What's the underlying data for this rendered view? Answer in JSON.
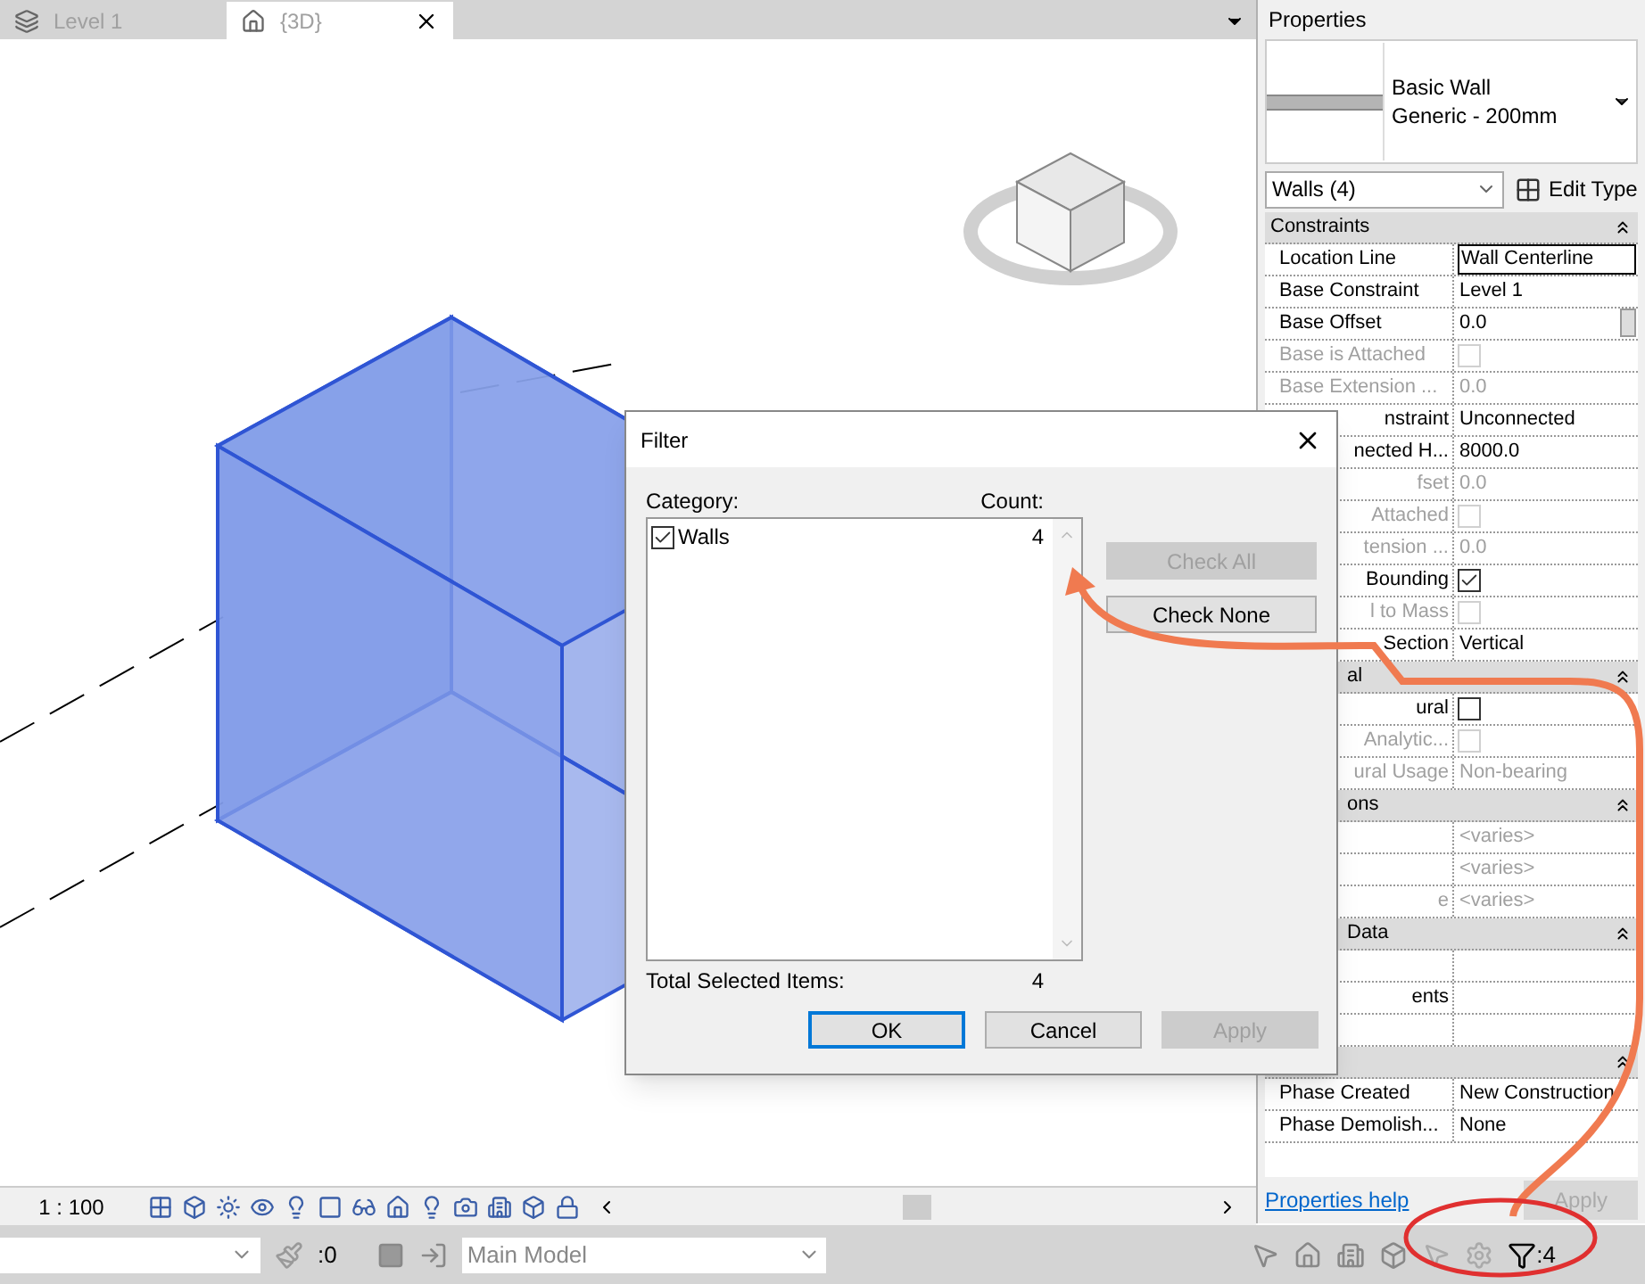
{
  "tabs": [
    {
      "label": "Level 1",
      "selected": false,
      "kind": "plan"
    },
    {
      "label": "{3D}",
      "selected": true,
      "kind": "house"
    }
  ],
  "properties": {
    "title": "Properties",
    "type_family": "Basic Wall",
    "type_name": "Generic - 200mm",
    "selector": "Walls (4)",
    "edit_type": "Edit Type",
    "sections": [
      {
        "title": "Constraints",
        "cut": false,
        "rows": [
          {
            "label": "Location Line",
            "kind": "text",
            "value": "Wall Centerline",
            "disabled": false,
            "cut": false,
            "editing": true
          },
          {
            "label": "Base Constraint",
            "kind": "text",
            "value": "Level 1",
            "disabled": false,
            "cut": false,
            "editing": false
          },
          {
            "label": "Base Offset",
            "kind": "text",
            "value": "0.0",
            "disabled": false,
            "cut": false,
            "editing": false
          },
          {
            "label": "Base is Attached",
            "kind": "checkbox",
            "checked": false,
            "disabled": true,
            "cut": false
          },
          {
            "label": "Base Extension ...",
            "kind": "text",
            "value": "0.0",
            "disabled": true,
            "cut": false,
            "editing": false
          },
          {
            "label": "nstraint",
            "kind": "text",
            "value": "Unconnected",
            "disabled": false,
            "cut": true,
            "editing": false
          },
          {
            "label": "nected H...",
            "kind": "text",
            "value": "8000.0",
            "disabled": false,
            "cut": true,
            "editing": false
          },
          {
            "label": "fset",
            "kind": "text",
            "value": "0.0",
            "disabled": true,
            "cut": true,
            "editing": false
          },
          {
            "label": "Attached",
            "kind": "checkbox",
            "checked": false,
            "disabled": true,
            "cut": true
          },
          {
            "label": "tension ...",
            "kind": "text",
            "value": "0.0",
            "disabled": true,
            "cut": true,
            "editing": false
          },
          {
            "label": "Bounding",
            "kind": "checkbox",
            "checked": true,
            "disabled": false,
            "cut": true
          },
          {
            "label": "l to Mass",
            "kind": "checkbox",
            "checked": false,
            "disabled": true,
            "cut": true
          },
          {
            "label": "Section",
            "kind": "text",
            "value": "Vertical",
            "disabled": false,
            "cut": true,
            "editing": false
          }
        ]
      },
      {
        "title": "al",
        "cut": true,
        "rows": [
          {
            "label": "ural",
            "kind": "checkbox",
            "checked": false,
            "disabled": false,
            "cut": true
          },
          {
            "label": "Analytic...",
            "kind": "checkbox",
            "checked": false,
            "disabled": true,
            "cut": true
          },
          {
            "label": "ural Usage",
            "kind": "text",
            "value": "Non-bearing",
            "disabled": true,
            "cut": true,
            "editing": false
          }
        ]
      },
      {
        "title": "ons",
        "cut": true,
        "rows": [
          {
            "kind": "text",
            "value": "<varies>",
            "disabled": true,
            "editing": false
          },
          {
            "kind": "text",
            "value": "<varies>",
            "disabled": true,
            "editing": false
          },
          {
            "label": "e",
            "kind": "text",
            "value": "<varies>",
            "disabled": true,
            "cut": true,
            "editing": false
          }
        ]
      },
      {
        "title": "Data",
        "cut": true,
        "rows": [
          {
            "kind": "blank"
          },
          {
            "label": "ents",
            "kind": "blank",
            "cut": true
          },
          {
            "kind": "blank"
          }
        ]
      },
      {
        "rows": [
          {
            "label": "Phase Created",
            "kind": "text",
            "value": "New Construction",
            "disabled": false,
            "cut": false,
            "editing": false
          },
          {
            "label": "Phase Demolish...",
            "kind": "text",
            "value": "None",
            "disabled": false,
            "cut": false,
            "editing": false
          }
        ]
      }
    ],
    "help": "Properties help",
    "apply": "Apply"
  },
  "filter_dialog": {
    "title": "Filter",
    "category_label": "Category:",
    "count_label": "Count:",
    "categories": [
      {
        "name": "Walls",
        "count": "4",
        "checked": true
      }
    ],
    "side_buttons": [
      {
        "label": "Check All",
        "disabled": true
      },
      {
        "label": "Check None",
        "disabled": false
      }
    ],
    "total_label": "Total Selected Items:",
    "total": "4",
    "buttons": [
      {
        "label": "OK",
        "disabled": false,
        "default": true
      },
      {
        "label": "Cancel",
        "disabled": false,
        "default": false
      },
      {
        "label": "Apply",
        "disabled": true,
        "default": false
      }
    ]
  },
  "view_bar": {
    "scale": "1 : 100"
  },
  "status_bar": {
    "select_count": ":0",
    "workset": "Main Model",
    "filter_count": ":4"
  }
}
